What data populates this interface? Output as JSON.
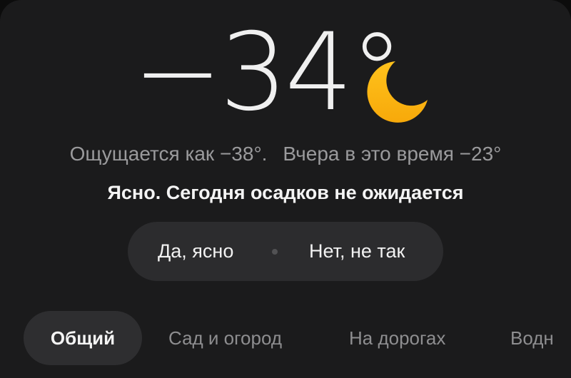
{
  "weather": {
    "temperature": "−34°",
    "condition_icon": "moon-icon",
    "feels_like": "Ощущается как −38°.",
    "yesterday": "Вчера в это время −23°",
    "condition": "Ясно. Сегодня осадков не ожидается"
  },
  "feedback": {
    "yes_label": "Да, ясно",
    "no_label": "Нет, не так"
  },
  "tabs": [
    {
      "label": "Общий",
      "active": true
    },
    {
      "label": "Сад и огород",
      "active": false
    },
    {
      "label": "На дорогах",
      "active": false
    },
    {
      "label": "Водн",
      "active": false
    }
  ],
  "colors": {
    "card_background": "#1b1b1c",
    "moon": "#f9b40f",
    "pill_background": "#2c2c2e"
  }
}
